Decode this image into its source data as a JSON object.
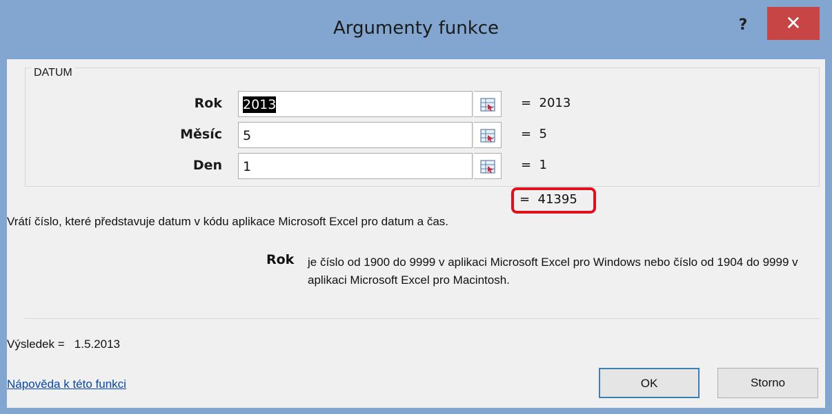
{
  "window": {
    "title": "Argumenty funkce",
    "help_glyph": "?",
    "close_glyph": "✕"
  },
  "function": {
    "name": "DATUM",
    "arguments": [
      {
        "label": "Rok",
        "value": "2013",
        "evaluated": "=  2013",
        "selected": true
      },
      {
        "label": "Měsíc",
        "value": "5",
        "evaluated": "=  5",
        "selected": false
      },
      {
        "label": "Den",
        "value": "1",
        "evaluated": "=  1",
        "selected": false
      }
    ],
    "formula_result": "=  41395",
    "description": "Vrátí číslo, které představuje datum v kódu aplikace Microsoft Excel pro datum a čas.",
    "active_arg_name": "Rok",
    "active_arg_description": "je číslo od 1900 do 9999 v aplikaci Microsoft Excel pro Windows nebo číslo od 1904 do 9999 v aplikaci Microsoft Excel pro Macintosh.",
    "result_line": "Výsledek =   1.5.2013"
  },
  "footer": {
    "help_link": "Nápověda k této funkci",
    "ok_label": "OK",
    "cancel_label": "Storno"
  },
  "colors": {
    "titlebar": "#82a6cf",
    "close_button": "#c74545",
    "highlight": "#e1101c",
    "link": "#0645ad"
  },
  "icons": {
    "ref_button": "collapse-dialog-icon"
  }
}
